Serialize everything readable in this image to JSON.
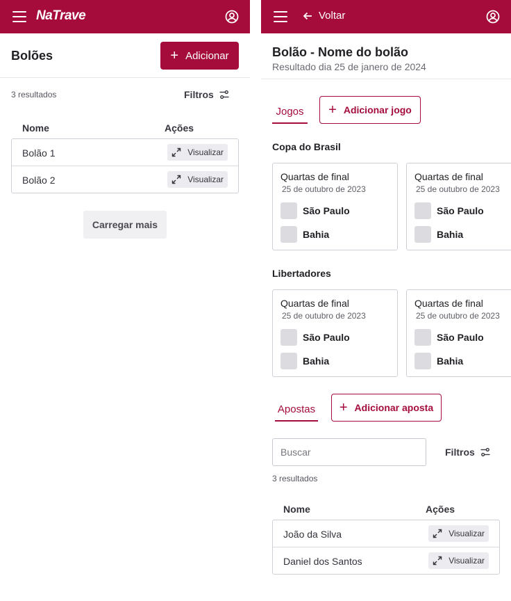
{
  "left": {
    "appbar": {
      "logo": "NaTrave"
    },
    "header": {
      "title": "Bolões",
      "add_label": "Adicionar"
    },
    "results": "3 resultados",
    "filters_label": "Filtros",
    "table": {
      "headers": [
        "Nome",
        "Ações"
      ],
      "rows": [
        {
          "name": "Bolão 1",
          "action": "Visualizar"
        },
        {
          "name": "Bolão 2",
          "action": "Visualizar"
        }
      ]
    },
    "load_more": "Carregar mais"
  },
  "right": {
    "appbar": {
      "back_label": "Voltar"
    },
    "header": {
      "title": "Bolão - Nome do bolão",
      "subtitle": "Resultado dia 25 de janero de 2024"
    },
    "games_tab": "Jogos",
    "add_game": "Adicionar jogo",
    "competitions": [
      {
        "name": "Copa do Brasil",
        "matches": [
          {
            "stage": "Quartas de final",
            "date": "25 de outubro de 2023",
            "home": "São Paulo",
            "away": "Bahia"
          },
          {
            "stage": "Quartas de final",
            "date": "25 de outubro de 2023",
            "home": "São Paulo",
            "away": "Bahia"
          }
        ]
      },
      {
        "name": "Libertadores",
        "matches": [
          {
            "stage": "Quartas de final",
            "date": "25 de outubro de 2023",
            "home": "São Paulo",
            "away": "Bahia"
          },
          {
            "stage": "Quartas de final",
            "date": "25 de outubro de 2023",
            "home": "São Paulo",
            "away": "Bahia"
          }
        ]
      }
    ],
    "bets_tab": "Apostas",
    "add_bet": "Adicionar aposta",
    "search": {
      "placeholder": "Buscar",
      "value": ""
    },
    "filters_label": "Filtros",
    "results": "3 resultados",
    "table": {
      "headers": [
        "Nome",
        "Ações"
      ],
      "rows": [
        {
          "name": "João da Silva",
          "action": "Visualizar"
        },
        {
          "name": "Daniel dos Santos",
          "action": "Visualizar"
        }
      ]
    }
  },
  "colors": {
    "brand": "#a50c3c",
    "surface": "#ffffff",
    "muted": "#ececf0"
  },
  "icons": [
    "menu-icon",
    "account-icon",
    "plus-icon",
    "filter-icon",
    "expand-icon",
    "arrow-left-icon"
  ]
}
